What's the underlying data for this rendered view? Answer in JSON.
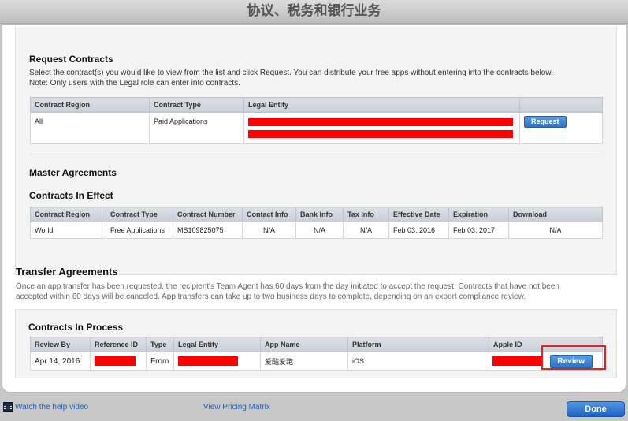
{
  "window": {
    "title": "协议、税务和银行业务"
  },
  "request_contracts": {
    "title": "Request Contracts",
    "description_line1": "Select the contract(s) you would like to view from the list and click Request. You can distribute your free apps without entering into the contracts below.",
    "description_line2": "Note: Only users with the Legal role can enter into contracts.",
    "columns": [
      "Contract Region",
      "Contract Type",
      "Legal Entity"
    ],
    "row": {
      "region": "All",
      "type": "Paid Applications",
      "legal_entity": "[redacted]"
    },
    "request_label": "Request"
  },
  "master_agreements": {
    "title": "Master Agreements",
    "subtitle": "Contracts In Effect",
    "columns": [
      "Contract Region",
      "Contract Type",
      "Contract Number",
      "Contact Info",
      "Bank Info",
      "Tax Info",
      "Effective Date",
      "Expiration",
      "Download"
    ],
    "row": {
      "region": "World",
      "type": "Free Applications",
      "number": "MS109825075",
      "contact_info": "N/A",
      "bank_info": "N/A",
      "tax_info": "N/A",
      "effective": "Feb 03, 2016",
      "expiration": "Feb 03, 2017",
      "download": "N/A"
    }
  },
  "transfer_agreements": {
    "title": "Transfer Agreements",
    "description_line1": "Once an app transfer has been requested, the recipient's Team Agent has 60 days from the day initiated to accept the request. Contracts that have not been",
    "description_line2": "accepted within 60 days will be canceled. App transfers can take up to two business days to complete, depending on an export compliance review."
  },
  "contracts_in_process": {
    "title": "Contracts In Process",
    "columns": [
      "Review By",
      "Reference ID",
      "Type",
      "Legal Entity",
      "App Name",
      "Platform",
      "Apple ID"
    ],
    "row": {
      "review_by": "Apr 14, 2016",
      "reference_id": "[redacted]",
      "type": "From",
      "legal_entity": "[redacted]",
      "app_name": "爱酷爱跑",
      "platform": "iOS",
      "apple_id": "[redacted]"
    },
    "review_label": "Review"
  },
  "footer": {
    "help_video": "Watch the help video",
    "pricing_matrix": "View Pricing Matrix",
    "done": "Done"
  },
  "colors": {
    "accent": "#2a72c4",
    "redaction": "#ff0000",
    "highlight": "#e52222"
  }
}
